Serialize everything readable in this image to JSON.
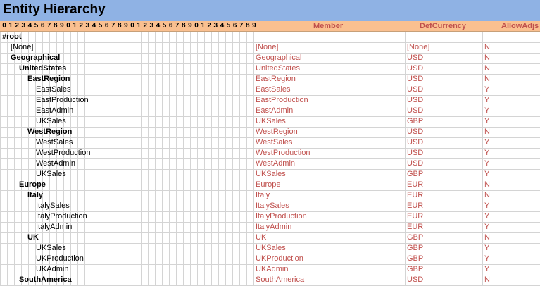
{
  "title": "Entity Hierarchy",
  "digits": [
    "0",
    "1",
    "2",
    "3",
    "4",
    "5",
    "6",
    "7",
    "8",
    "9",
    "0",
    "1",
    "2",
    "3",
    "4",
    "5",
    "6",
    "7",
    "8",
    "9",
    "0",
    "1",
    "2",
    "3",
    "4",
    "5",
    "6",
    "7",
    "8",
    "9",
    "0",
    "1",
    "2",
    "3",
    "4",
    "5",
    "6",
    "7",
    "8",
    "9"
  ],
  "columns": {
    "member": "Member",
    "defcurrency": "DefCurrency",
    "allowadjs": "AllowAdjs"
  },
  "rows": [
    {
      "label": "#root",
      "level": 0,
      "bold": true,
      "member": "",
      "currency": "",
      "allow": ""
    },
    {
      "label": "[None]",
      "level": 1,
      "bold": false,
      "member": "[None]",
      "currency": "[None]",
      "allow": "N"
    },
    {
      "label": "Geographical",
      "level": 1,
      "bold": true,
      "member": "Geographical",
      "currency": "USD",
      "allow": "N"
    },
    {
      "label": "UnitedStates",
      "level": 2,
      "bold": true,
      "member": "UnitedStates",
      "currency": "USD",
      "allow": "N"
    },
    {
      "label": "EastRegion",
      "level": 3,
      "bold": true,
      "member": "EastRegion",
      "currency": "USD",
      "allow": "N"
    },
    {
      "label": "EastSales",
      "level": 4,
      "bold": false,
      "member": "EastSales",
      "currency": "USD",
      "allow": "Y"
    },
    {
      "label": "EastProduction",
      "level": 4,
      "bold": false,
      "member": "EastProduction",
      "currency": "USD",
      "allow": "Y"
    },
    {
      "label": "EastAdmin",
      "level": 4,
      "bold": false,
      "member": "EastAdmin",
      "currency": "USD",
      "allow": "Y"
    },
    {
      "label": "UKSales",
      "level": 4,
      "bold": false,
      "member": "UKSales",
      "currency": "GBP",
      "allow": "Y"
    },
    {
      "label": "WestRegion",
      "level": 3,
      "bold": true,
      "member": "WestRegion",
      "currency": "USD",
      "allow": "N"
    },
    {
      "label": "WestSales",
      "level": 4,
      "bold": false,
      "member": "WestSales",
      "currency": "USD",
      "allow": "Y"
    },
    {
      "label": "WestProduction",
      "level": 4,
      "bold": false,
      "member": "WestProduction",
      "currency": "USD",
      "allow": "Y"
    },
    {
      "label": "WestAdmin",
      "level": 4,
      "bold": false,
      "member": "WestAdmin",
      "currency": "USD",
      "allow": "Y"
    },
    {
      "label": "UKSales",
      "level": 4,
      "bold": false,
      "member": "UKSales",
      "currency": "GBP",
      "allow": "Y"
    },
    {
      "label": "Europe",
      "level": 2,
      "bold": true,
      "member": "Europe",
      "currency": "EUR",
      "allow": "N"
    },
    {
      "label": "Italy",
      "level": 3,
      "bold": true,
      "member": "Italy",
      "currency": "EUR",
      "allow": "N"
    },
    {
      "label": "ItalySales",
      "level": 4,
      "bold": false,
      "member": "ItalySales",
      "currency": "EUR",
      "allow": "Y"
    },
    {
      "label": "ItalyProduction",
      "level": 4,
      "bold": false,
      "member": "ItalyProduction",
      "currency": "EUR",
      "allow": "Y"
    },
    {
      "label": "ItalyAdmin",
      "level": 4,
      "bold": false,
      "member": "ItalyAdmin",
      "currency": "EUR",
      "allow": "Y"
    },
    {
      "label": "UK",
      "level": 3,
      "bold": true,
      "member": "UK",
      "currency": "GBP",
      "allow": "N"
    },
    {
      "label": "UKSales",
      "level": 4,
      "bold": false,
      "member": "UKSales",
      "currency": "GBP",
      "allow": "Y"
    },
    {
      "label": "UKProduction",
      "level": 4,
      "bold": false,
      "member": "UKProduction",
      "currency": "GBP",
      "allow": "Y"
    },
    {
      "label": "UKAdmin",
      "level": 4,
      "bold": false,
      "member": "UKAdmin",
      "currency": "GBP",
      "allow": "Y"
    },
    {
      "label": "SouthAmerica",
      "level": 2,
      "bold": true,
      "member": "SouthAmerica",
      "currency": "USD",
      "allow": "N"
    }
  ],
  "colors": {
    "title_bg": "#8fb2e4",
    "header_bg": "#fac090",
    "value_text": "#c0504d"
  }
}
